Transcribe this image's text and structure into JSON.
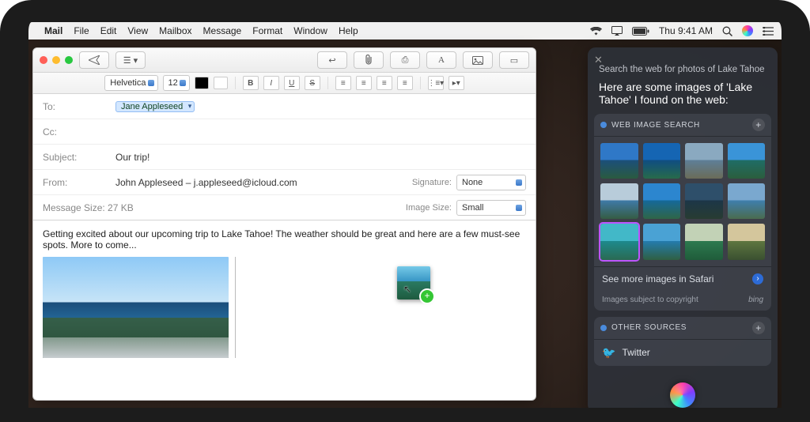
{
  "menubar": {
    "apple": "",
    "menus": [
      "Mail",
      "File",
      "Edit",
      "View",
      "Mailbox",
      "Message",
      "Format",
      "Window",
      "Help"
    ],
    "time": "Thu 9:41 AM"
  },
  "mail": {
    "fields": {
      "to_label": "To:",
      "to_token": "Jane Appleseed",
      "cc_label": "Cc:",
      "subject_label": "Subject:",
      "subject_value": "Our trip!",
      "from_label": "From:",
      "from_value": "John Appleseed – j.appleseed@icloud.com",
      "signature_label": "Signature:",
      "signature_value": "None",
      "size_label": "Message Size:  27 KB",
      "image_size_label": "Image Size:",
      "image_size_value": "Small"
    },
    "format": {
      "font": "Helvetica",
      "size": "12"
    },
    "body_text": "Getting excited about our upcoming trip to Lake Tahoe! The weather should be great and here are a few must-see spots. More to come..."
  },
  "siri": {
    "query": "Search the web for photos of Lake Tahoe",
    "heading": "Here are some images of 'Lake Tahoe' I found on the web:",
    "section_title": "WEB IMAGE SEARCH",
    "see_more": "See more images in Safari",
    "copyright": "Images subject to copyright",
    "provider": "bing",
    "other_title": "OTHER SOURCES",
    "other_item": "Twitter"
  },
  "thumbs": [
    {
      "sky": "#2f78c7",
      "water": "#1b4f7a",
      "land": "#2a5a3f"
    },
    {
      "sky": "#1565b3",
      "water": "#0f4d82",
      "land": "#276a4a"
    },
    {
      "sky": "#8aa9c0",
      "water": "#5e7f98",
      "land": "#6a6c58"
    },
    {
      "sky": "#3a94d8",
      "water": "#1f6d66",
      "land": "#2b5e3d"
    },
    {
      "sky": "#b8ccda",
      "water": "#3f7aa8",
      "land": "#355c44"
    },
    {
      "sky": "#2c86cf",
      "water": "#15699a",
      "land": "#2f6547"
    },
    {
      "sky": "#2e4f6a",
      "water": "#1c3648",
      "land": "#283c32"
    },
    {
      "sky": "#7aa8cf",
      "water": "#3f7fae",
      "land": "#4a6b4f"
    },
    {
      "sky": "#42b8c8",
      "water": "#1d8a8d",
      "land": "#2a6a52"
    },
    {
      "sky": "#4aa2d4",
      "water": "#247cae",
      "land": "#2f5f42"
    },
    {
      "sky": "#c2d2b6",
      "water": "#2d7a4f",
      "land": "#1f5c3a"
    },
    {
      "sky": "#d4c69c",
      "water": "#5e7640",
      "land": "#3a5030"
    }
  ]
}
